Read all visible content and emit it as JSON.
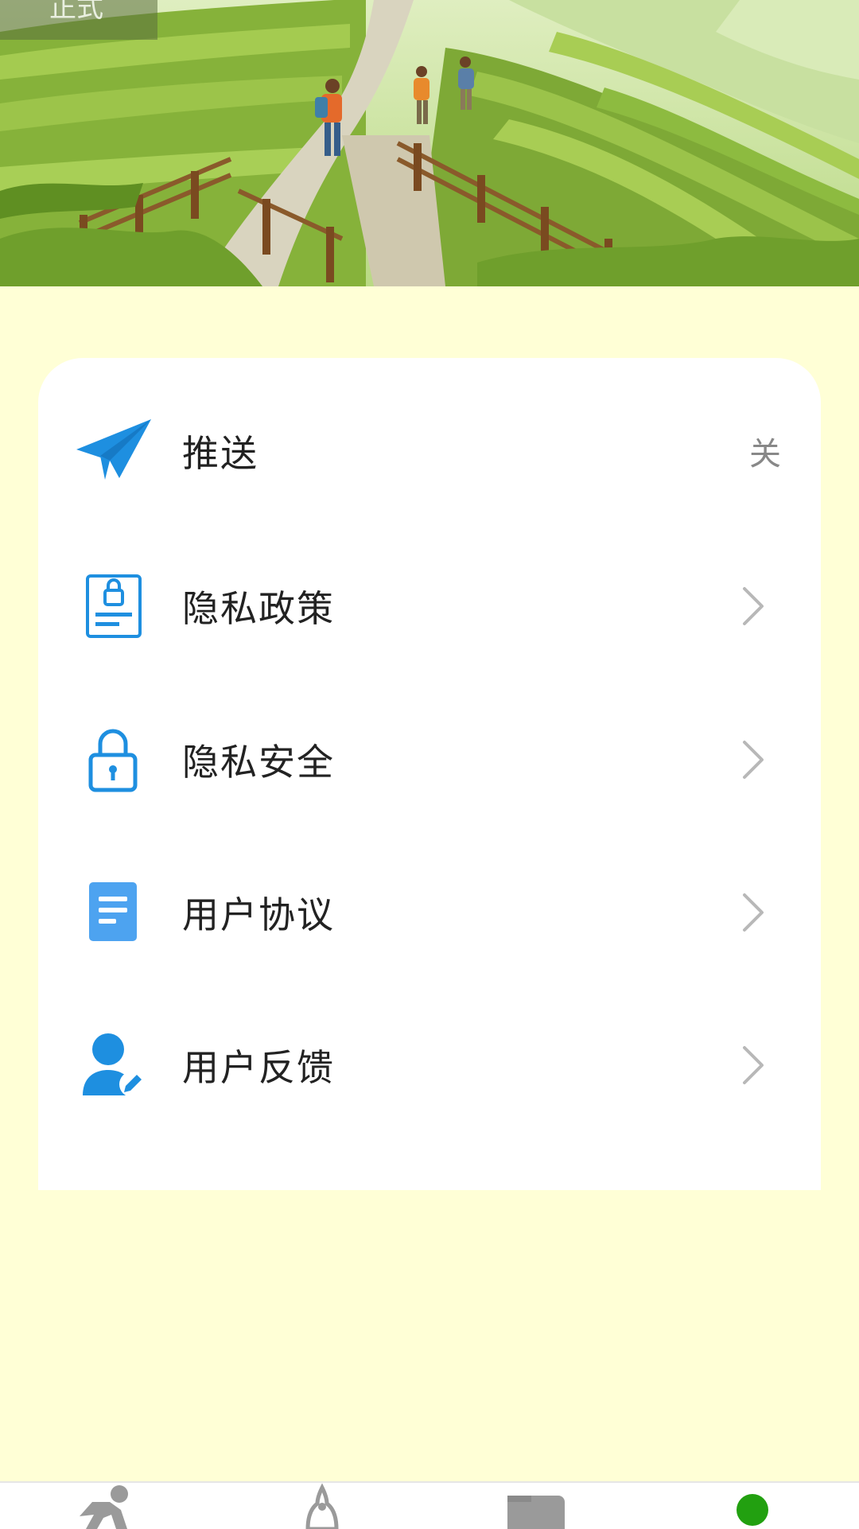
{
  "header": {
    "env_badge": "正式",
    "illustration": "tea-terrace-hiking-illustration"
  },
  "settings": {
    "items": [
      {
        "id": "push",
        "label": "推送",
        "icon": "paper-plane-icon",
        "value": "关"
      },
      {
        "id": "privacy-policy",
        "label": "隐私政策",
        "icon": "privacy-document-icon",
        "trailing": "chevron-right-icon"
      },
      {
        "id": "privacy-security",
        "label": "隐私安全",
        "icon": "padlock-icon",
        "trailing": "chevron-right-icon"
      },
      {
        "id": "user-agreement",
        "label": "用户协议",
        "icon": "document-icon",
        "trailing": "chevron-right-icon"
      },
      {
        "id": "user-feedback",
        "label": "用户反馈",
        "icon": "user-edit-icon",
        "trailing": "chevron-right-icon"
      }
    ]
  },
  "tabbar": {
    "tabs": [
      {
        "icon": "running-icon"
      },
      {
        "icon": "meditation-icon"
      },
      {
        "icon": "card-icon"
      },
      {
        "icon": "active-dot-icon",
        "active": true
      }
    ]
  },
  "colors": {
    "page_background": "#ffffd6",
    "card_background": "#ffffff",
    "icon_blue": "#1e8fe0",
    "icon_blue_light": "#4da3f0",
    "active_tab": "#22a010"
  }
}
